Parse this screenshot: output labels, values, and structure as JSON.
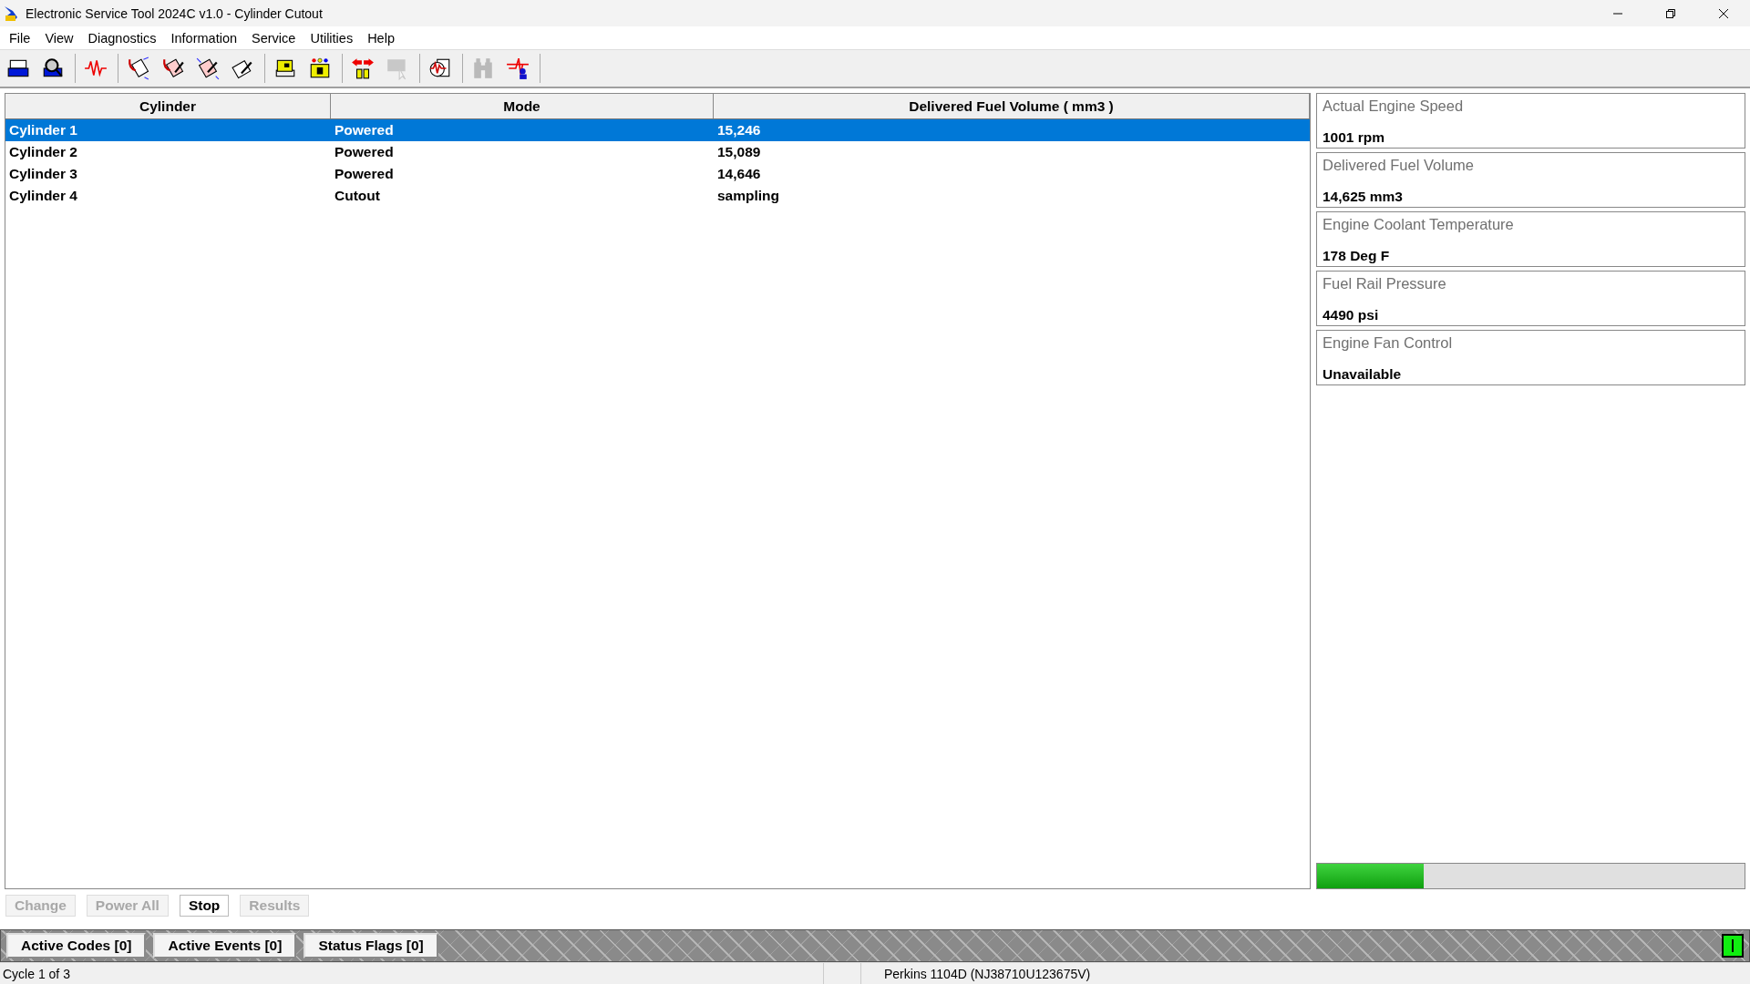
{
  "window": {
    "title": "Electronic Service Tool 2024C v1.0 - Cylinder Cutout"
  },
  "menu": [
    "File",
    "View",
    "Diagnostics",
    "Information",
    "Service",
    "Utilities",
    "Help"
  ],
  "toolbar": {
    "groups": [
      [
        {
          "disabled": false
        },
        {
          "disabled": false
        }
      ],
      [
        {
          "disabled": false
        }
      ],
      [
        {
          "disabled": false
        },
        {
          "disabled": false
        },
        {
          "disabled": false
        },
        {
          "disabled": false
        }
      ],
      [
        {
          "disabled": false
        },
        {
          "disabled": false
        }
      ],
      [
        {
          "disabled": false
        },
        {
          "disabled": true
        }
      ],
      [
        {
          "disabled": false
        }
      ],
      [
        {
          "disabled": true
        },
        {
          "disabled": false
        }
      ]
    ]
  },
  "table": {
    "columns": [
      "Cylinder",
      "Mode",
      "Delivered Fuel Volume ( mm3 )"
    ],
    "rows": [
      {
        "cells": [
          "Cylinder 1",
          "Powered",
          "15,246"
        ],
        "selected": true
      },
      {
        "cells": [
          "Cylinder 2",
          "Powered",
          "15,089"
        ],
        "selected": false
      },
      {
        "cells": [
          "Cylinder 3",
          "Powered",
          "14,646"
        ],
        "selected": false
      },
      {
        "cells": [
          "Cylinder 4",
          "Cutout",
          "sampling"
        ],
        "selected": false
      }
    ]
  },
  "parameters": [
    {
      "label": "Actual Engine Speed",
      "value": "1001 rpm"
    },
    {
      "label": "Delivered Fuel Volume",
      "value": "14,625 mm3"
    },
    {
      "label": "Engine Coolant Temperature",
      "value": "178 Deg F"
    },
    {
      "label": "Fuel Rail Pressure",
      "value": "4490 psi"
    },
    {
      "label": "Engine Fan Control",
      "value": "Unavailable"
    }
  ],
  "progress": {
    "level": 0.25
  },
  "buttons": [
    {
      "label": "Change",
      "disabled": true
    },
    {
      "label": "Power All",
      "disabled": true
    },
    {
      "label": "Stop",
      "disabled": false
    },
    {
      "label": "Results",
      "disabled": true
    }
  ],
  "tabs": [
    "Active Codes [0]",
    "Active Events [0]",
    "Status Flags [0]"
  ],
  "status_bar": {
    "left": "Cycle 1 of 3",
    "right": "Perkins 1104D (NJ38710U123675V)"
  }
}
